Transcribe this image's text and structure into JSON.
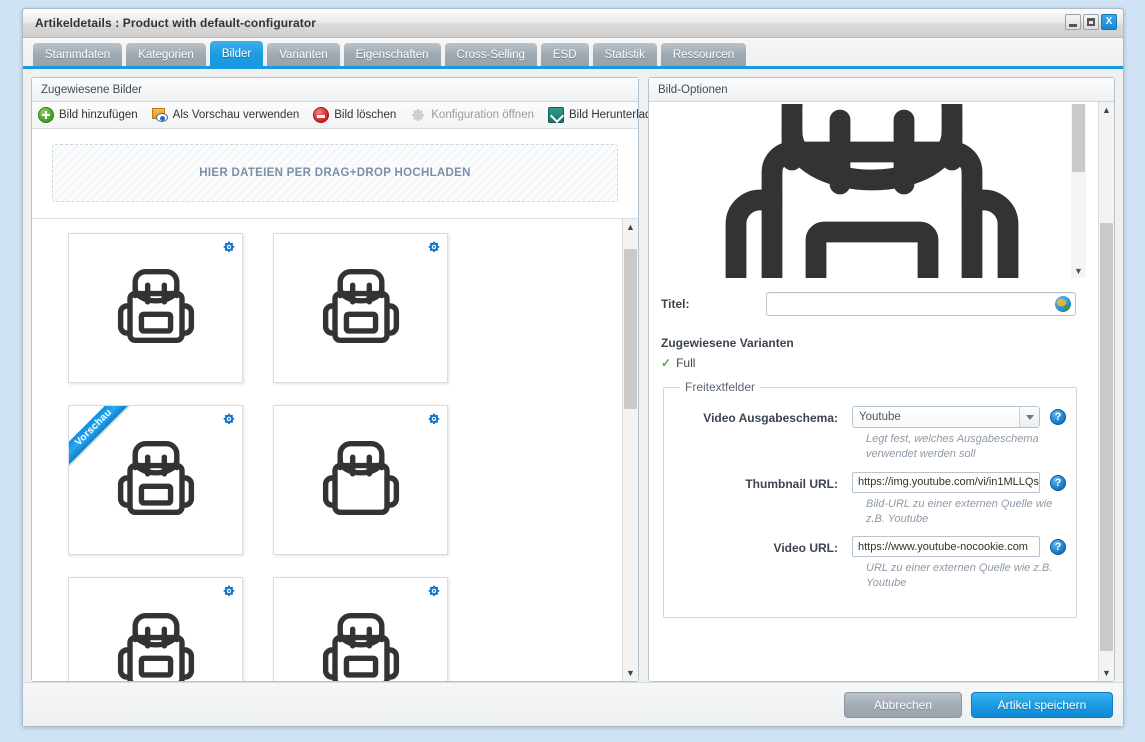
{
  "window": {
    "title": "Artikeldetails : Product with default-configurator",
    "minimize_label": "Minimieren",
    "maximize_label": "Maximieren",
    "close_label": "X"
  },
  "tabs": [
    {
      "label": "Stammdaten",
      "active": false
    },
    {
      "label": "Kategorien",
      "active": false
    },
    {
      "label": "Bilder",
      "active": true
    },
    {
      "label": "Varianten",
      "active": false
    },
    {
      "label": "Eigenschaften",
      "active": false
    },
    {
      "label": "Cross-Selling",
      "active": false
    },
    {
      "label": "ESD",
      "active": false
    },
    {
      "label": "Statistik",
      "active": false
    },
    {
      "label": "Ressourcen",
      "active": false
    }
  ],
  "left_panel": {
    "header": "Zugewiesene Bilder",
    "toolbar": [
      {
        "label": "Bild hinzufügen",
        "icon": "plus-circle-green-icon",
        "disabled": false
      },
      {
        "label": "Als Vorschau verwenden",
        "icon": "preview-eye-icon",
        "disabled": false
      },
      {
        "label": "Bild löschen",
        "icon": "minus-circle-red-icon",
        "disabled": false
      },
      {
        "label": "Konfiguration öffnen",
        "icon": "gear-gray-icon",
        "disabled": true
      },
      {
        "label": "Bild Herunterladen",
        "icon": "download-teal-icon",
        "disabled": false
      }
    ],
    "dropzone_label": "HIER DATEIEN PER DRAG+DROP HOCHLADEN",
    "thumbnails": [
      {
        "name": "backpack-with-pocket",
        "variant": "pocket",
        "ribbon": null
      },
      {
        "name": "backpack-with-pocket",
        "variant": "pocket",
        "ribbon": null
      },
      {
        "name": "backpack-preview",
        "variant": "pocket",
        "ribbon": "Vorschau"
      },
      {
        "name": "backpack-plain",
        "variant": "plain",
        "ribbon": null
      },
      {
        "name": "backpack-with-pocket",
        "variant": "pocket",
        "ribbon": null
      },
      {
        "name": "backpack-with-pocket",
        "variant": "pocket",
        "ribbon": null
      }
    ],
    "gear_badge_name": "gear-blue-icon"
  },
  "right_panel": {
    "header": "Bild-Optionen",
    "preview_image_name": "backpack-large-preview",
    "title_field": {
      "label": "Titel:",
      "value": "",
      "placeholder": "",
      "globe_icon": "globe-icon"
    },
    "variants": {
      "heading": "Zugewiesene Varianten",
      "items": [
        {
          "label": "Full",
          "checked": true
        }
      ]
    },
    "freetext": {
      "legend": "Freitextfelder",
      "fields": [
        {
          "label": "Video Ausgabeschema:",
          "type": "select",
          "value": "Youtube",
          "options": [
            "Youtube"
          ],
          "hint": "Legt fest, welches Ausgabeschema verwendet werden soll",
          "help": "?"
        },
        {
          "label": "Thumbnail URL:",
          "type": "text",
          "value": "https://img.youtube.com/vi/in1MLLQs",
          "hint": "Bild-URL zu einer externen Quelle wie z.B. Youtube",
          "help": "?"
        },
        {
          "label": "Video URL:",
          "type": "text",
          "value": "https://www.youtube-nocookie.com",
          "hint": "URL zu einer externen Quelle wie z.B. Youtube",
          "help": "?"
        }
      ]
    }
  },
  "footer": {
    "cancel_label": "Abbrechen",
    "save_label": "Artikel speichern"
  },
  "colors": {
    "accent": "#189bde",
    "tab_inactive": "#9fa9b1",
    "ribbon": "#0d8de0",
    "success": "#4caf50",
    "danger": "#cf2020"
  }
}
